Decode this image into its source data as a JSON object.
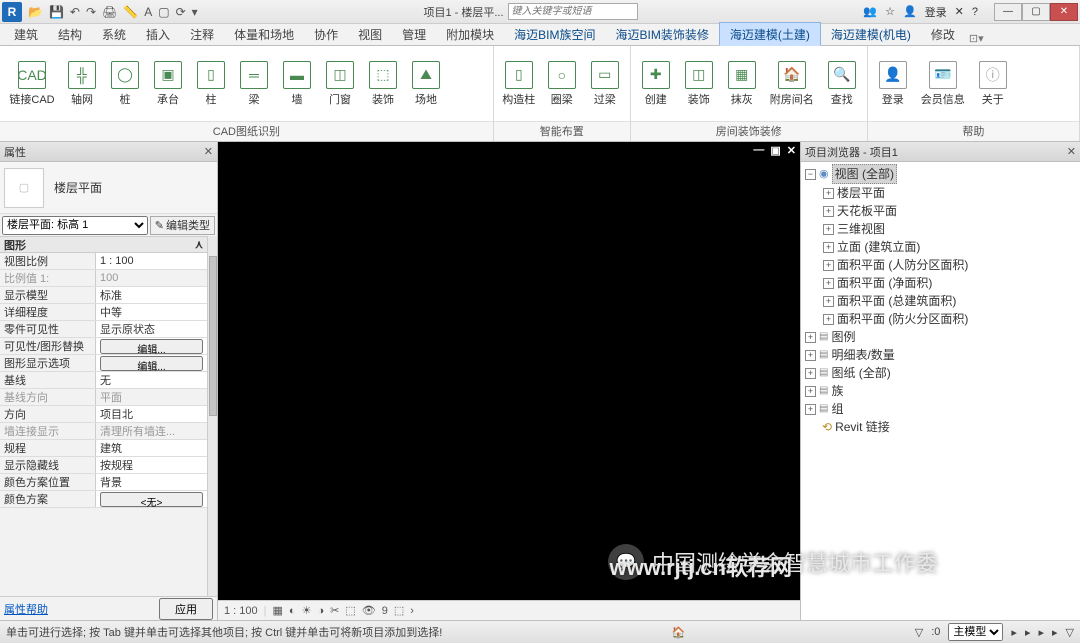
{
  "title": "项目1 - 楼层平...",
  "search_placeholder": "键入关键字或短语",
  "login": "登录",
  "menuTabs": [
    "建筑",
    "结构",
    "系统",
    "插入",
    "注释",
    "体量和场地",
    "协作",
    "视图",
    "管理",
    "附加模块",
    "海迈BIM族空间",
    "海迈BIM装饰装修",
    "海迈建模(土建)",
    "海迈建模(机电)",
    "修改"
  ],
  "ribbon": {
    "g1": {
      "items": [
        "链接CAD",
        "轴网",
        "桩",
        "承台",
        "柱",
        "梁",
        "墙",
        "门窗",
        "装饰",
        "场地"
      ],
      "title": "CAD图纸识别"
    },
    "g2": {
      "items": [
        "构造柱",
        "圈梁",
        "过梁"
      ],
      "title": "智能布置"
    },
    "g3": {
      "items": [
        "创建",
        "装饰",
        "抹灰",
        "附房间名",
        "查找"
      ],
      "title": "房间装饰装修"
    },
    "g4": {
      "items": [
        "登录",
        "会员信息",
        "关于"
      ],
      "title": "帮助"
    }
  },
  "propPanel": {
    "title": "属性",
    "typeName": "楼层平面",
    "selector": "楼层平面: 标高 1",
    "editType": "编辑类型",
    "category": "图形",
    "rows": [
      {
        "n": "视图比例",
        "v": "1 : 100"
      },
      {
        "n": "比例值 1:",
        "v": "100",
        "dim": true
      },
      {
        "n": "显示模型",
        "v": "标准"
      },
      {
        "n": "详细程度",
        "v": "中等"
      },
      {
        "n": "零件可见性",
        "v": "显示原状态"
      },
      {
        "n": "可见性/图形替换",
        "btn": "编辑..."
      },
      {
        "n": "图形显示选项",
        "btn": "编辑..."
      },
      {
        "n": "基线",
        "v": "无"
      },
      {
        "n": "基线方向",
        "v": "平面",
        "dim": true
      },
      {
        "n": "方向",
        "v": "项目北"
      },
      {
        "n": "墙连接显示",
        "v": "清理所有墙连...",
        "dim": true
      },
      {
        "n": "规程",
        "v": "建筑"
      },
      {
        "n": "显示隐藏线",
        "v": "按规程"
      },
      {
        "n": "颜色方案位置",
        "v": "背景"
      },
      {
        "n": "颜色方案",
        "btn": "<无>"
      }
    ],
    "helpLink": "属性帮助",
    "applyBtn": "应用"
  },
  "viewbar": {
    "scale": "1 : 100"
  },
  "browser": {
    "title": "项目浏览器 - 项目1",
    "root": "视图 (全部)",
    "lvl1": [
      "楼层平面",
      "天花板平面",
      "三维视图",
      "立面 (建筑立面)",
      "面积平面 (人防分区面积)",
      "面积平面 (净面积)",
      "面积平面 (总建筑面积)",
      "面积平面 (防火分区面积)"
    ],
    "top": [
      "图例",
      "明细表/数量",
      "图纸 (全部)",
      "族",
      "组",
      "Revit 链接"
    ]
  },
  "status": "单击可进行选择; 按 Tab 键并单击可选择其他项目; 按 Ctrl 键并单击可将新项目添加到选择!",
  "statusRight": {
    "zero": ":0",
    "model": "主模型"
  },
  "watermark": "中国测绘学会智慧城市工作委",
  "watermarkR": "www.rjtj.cn软荐网"
}
